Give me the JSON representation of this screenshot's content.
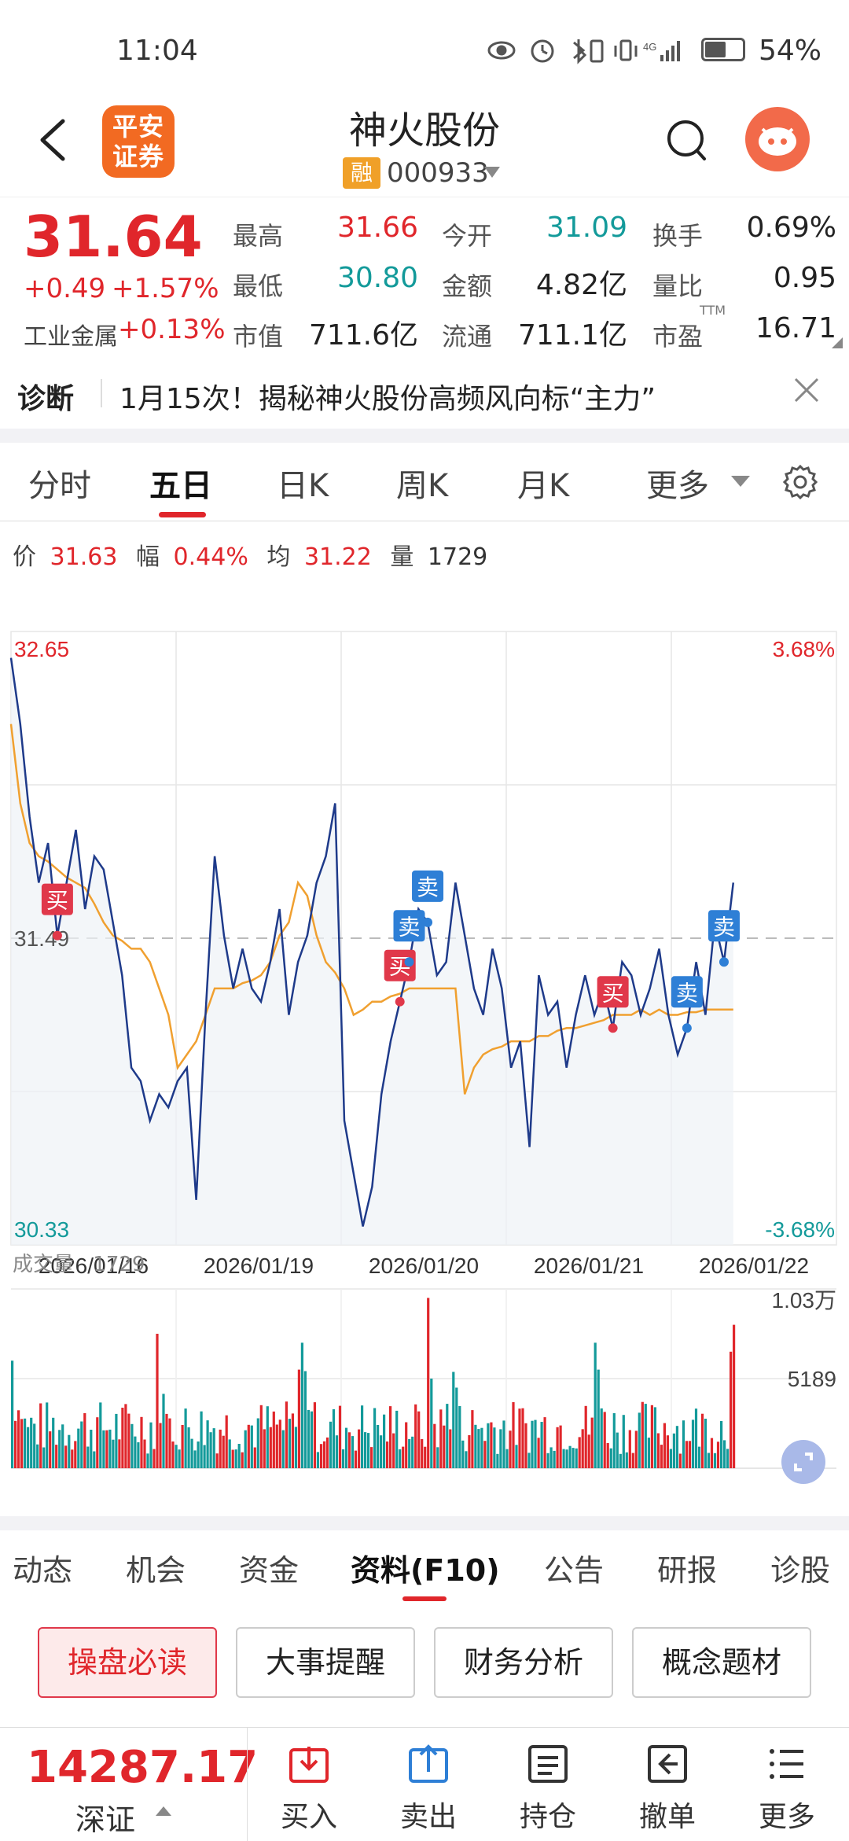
{
  "status_bar": {
    "time": "11:04",
    "battery": "54%"
  },
  "header": {
    "broker_logo": "平安证券",
    "stock_name": "神火股份",
    "rong_badge": "融",
    "stock_code": "000933"
  },
  "quote": {
    "price": "31.64",
    "change": "+0.49",
    "change_pct": "+1.57%",
    "sector_label": "工业金属",
    "sector_change": "+0.13%",
    "fields": [
      {
        "label": "最高",
        "value": "31.66"
      },
      {
        "label": "今开",
        "value": "31.09"
      },
      {
        "label": "换手",
        "value": "0.69%"
      },
      {
        "label": "最低",
        "value": "30.80"
      },
      {
        "label": "金额",
        "value": "4.82亿"
      },
      {
        "label": "量比",
        "value": "0.95"
      },
      {
        "label": "市值",
        "value": "711.6亿"
      },
      {
        "label": "流通",
        "value": "711.1亿"
      },
      {
        "label": "市盈",
        "value": "16.71"
      }
    ],
    "pe_superscript": "TTM"
  },
  "diagnosis": {
    "label": "诊断",
    "headline": "1月15次！揭秘神火股份高频风向标“主力”"
  },
  "chart_tabs": [
    "分时",
    "五日",
    "日K",
    "周K",
    "月K",
    "更多"
  ],
  "info_bar": {
    "price_label": "价",
    "price": "31.63",
    "amp_label": "幅",
    "amp": "0.44%",
    "avg_label": "均",
    "avg": "31.22",
    "vol_label": "量",
    "vol": "1729"
  },
  "volume_header": {
    "label": "成交量",
    "value": "1729"
  },
  "trade_marks": [
    {
      "label": "买",
      "type": "buy"
    },
    {
      "label": "买",
      "type": "buy"
    },
    {
      "label": "卖",
      "type": "sell"
    },
    {
      "label": "卖",
      "type": "sell"
    },
    {
      "label": "买",
      "type": "buy"
    },
    {
      "label": "卖",
      "type": "sell"
    },
    {
      "label": "卖",
      "type": "sell"
    }
  ],
  "f10_tabs": [
    "动态",
    "机会",
    "资金",
    "资料(F10)",
    "公告",
    "研报",
    "诊股"
  ],
  "f10_buttons": [
    "操盘必读",
    "大事提醒",
    "财务分析",
    "概念题材"
  ],
  "bottom_bar": {
    "index_value": "14287.17",
    "index_name": "深证",
    "actions": [
      "买入",
      "卖出",
      "持仓",
      "撤单",
      "更多"
    ]
  },
  "colors": {
    "up": "#e0262b",
    "down": "#139a9a",
    "price_line": "#1e3a8a",
    "avg_line": "#f0a030",
    "buy_badge": "#e0384a",
    "sell_badge": "#2e7fd6"
  },
  "chart_data": {
    "type": "line",
    "x_labels": [
      "2026/01/16",
      "2026/01/19",
      "2026/01/20",
      "2026/01/21",
      "2026/01/22"
    ],
    "prev_close": 31.49,
    "ylim": [
      30.33,
      32.65
    ],
    "pct_range": [
      "3.68%",
      "-3.68%"
    ],
    "y_labels": {
      "top": "32.65",
      "mid": "31.49",
      "bottom": "30.33"
    },
    "series": [
      {
        "values": [
          32.55,
          32.3,
          31.95,
          31.7,
          31.85,
          31.5,
          31.7,
          31.9,
          31.6,
          31.8,
          31.75,
          31.55,
          31.35,
          31.0,
          30.95,
          30.8,
          30.9,
          30.85,
          30.95,
          31.0,
          30.5,
          31.2,
          31.8,
          31.5,
          31.3,
          31.45,
          31.3,
          31.25,
          31.4,
          31.6,
          31.2,
          31.4,
          31.5,
          31.7,
          31.8,
          32.0,
          30.8,
          30.6,
          30.4,
          30.55,
          30.9,
          31.1,
          31.25,
          31.4,
          31.6,
          31.55,
          31.35,
          31.4,
          31.7,
          31.5,
          31.3,
          31.2,
          31.45,
          31.3,
          31.0,
          31.1,
          30.7,
          31.35,
          31.2,
          31.25,
          31.0,
          31.2,
          31.35,
          31.2,
          31.3,
          31.15,
          31.4,
          31.35,
          31.2,
          31.3,
          31.45,
          31.2,
          31.05,
          31.15,
          31.4,
          31.2,
          31.55,
          31.4,
          31.7
        ]
      },
      {
        "values": [
          32.3,
          32.0,
          31.85,
          31.8,
          31.78,
          31.75,
          31.72,
          31.7,
          31.68,
          31.62,
          31.55,
          31.5,
          31.48,
          31.45,
          31.45,
          31.4,
          31.3,
          31.2,
          31.0,
          31.05,
          31.1,
          31.2,
          31.3,
          31.3,
          31.3,
          31.32,
          31.33,
          31.35,
          31.4,
          31.5,
          31.55,
          31.7,
          31.65,
          31.5,
          31.4,
          31.36,
          31.3,
          31.2,
          31.22,
          31.25,
          31.25,
          31.27,
          31.28,
          31.3,
          31.3,
          31.3,
          31.3,
          31.3,
          31.3,
          30.9,
          31.0,
          31.05,
          31.07,
          31.08,
          31.1,
          31.1,
          31.1,
          31.12,
          31.12,
          31.14,
          31.15,
          31.15,
          31.16,
          31.17,
          31.18,
          31.2,
          31.2,
          31.2,
          31.22,
          31.2,
          31.22,
          31.2,
          31.2,
          31.21,
          31.21,
          31.22,
          31.22,
          31.22,
          31.22
        ]
      }
    ]
  }
}
